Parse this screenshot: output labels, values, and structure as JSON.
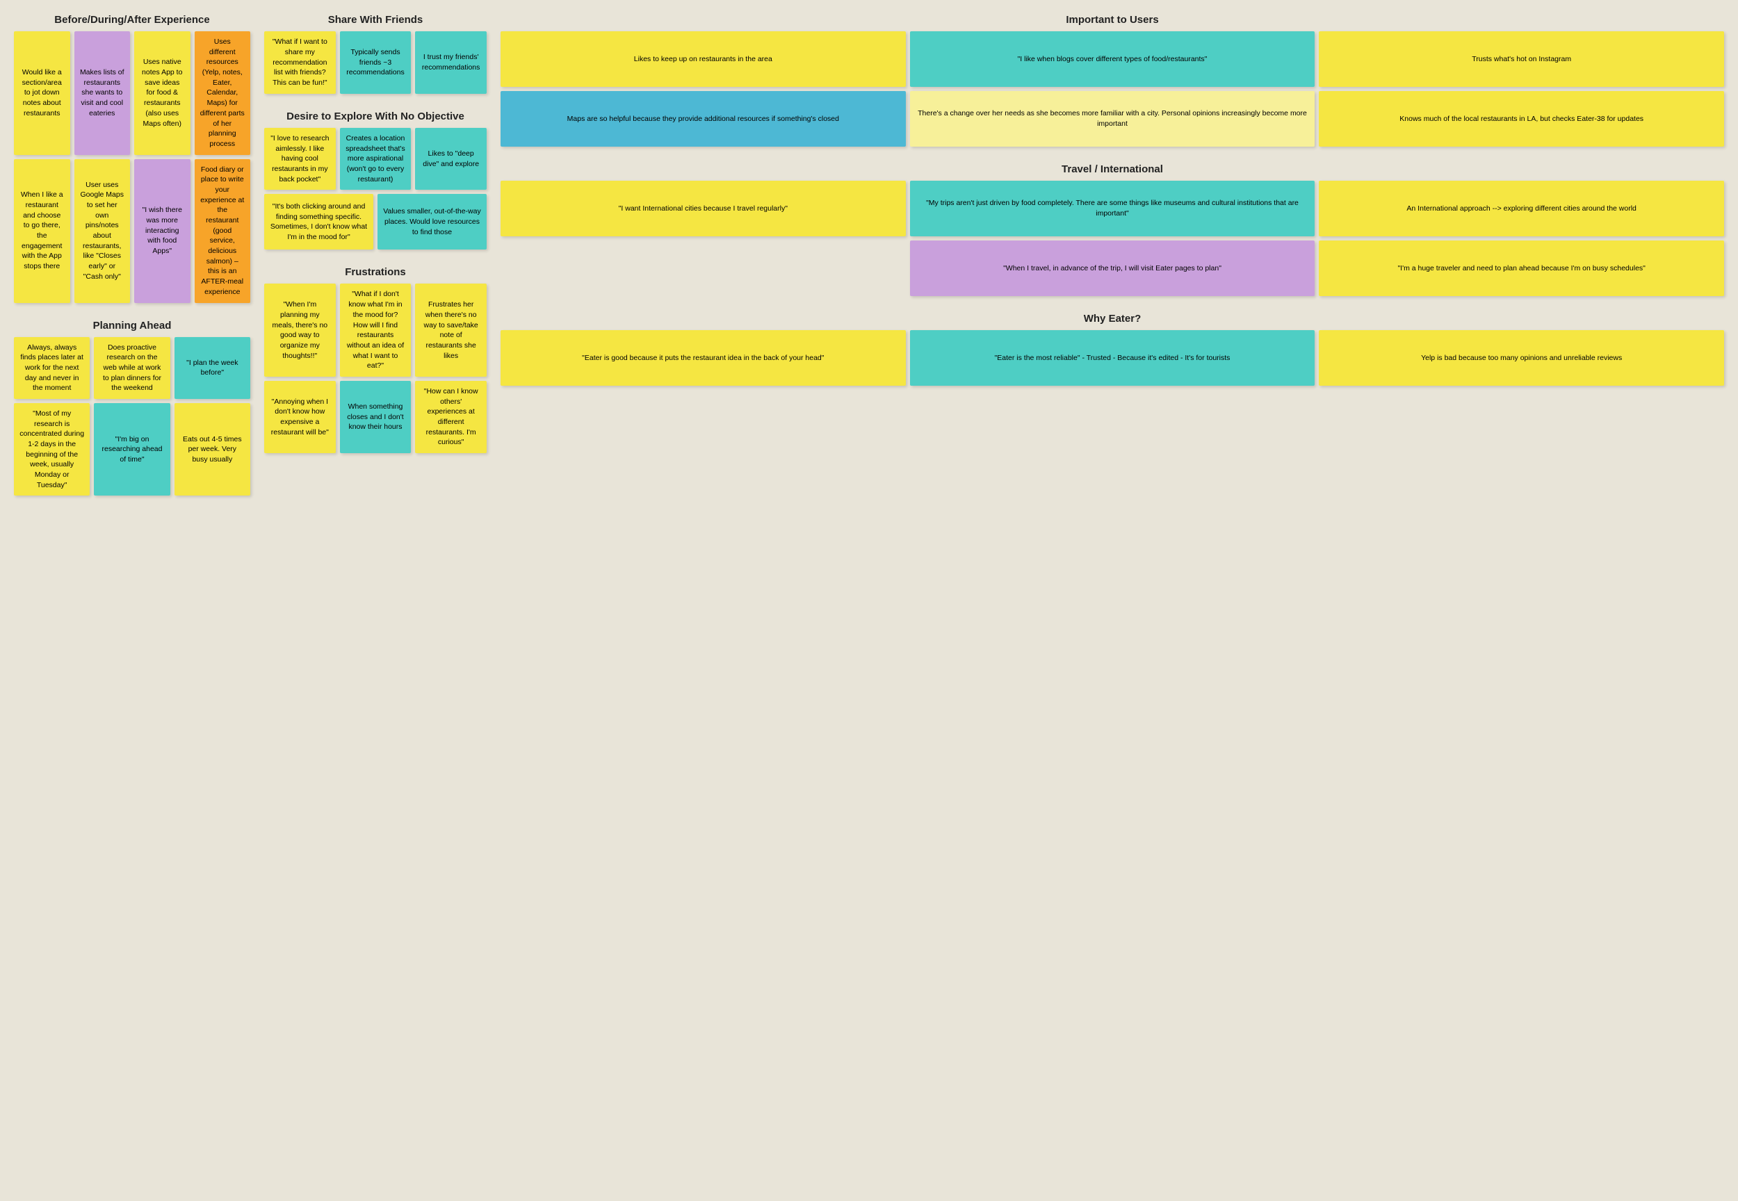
{
  "sections": {
    "beforeDuringAfter": {
      "title": "Before/During/After Experience",
      "row1": [
        {
          "text": "Would like a section/area to jot down notes about restaurants",
          "color": "sticky-yellow"
        },
        {
          "text": "Makes lists of restaurants she wants to visit and cool eateries",
          "color": "sticky-purple"
        },
        {
          "text": "Uses native notes App to save ideas for food & restaurants (also uses Maps often)",
          "color": "sticky-yellow"
        },
        {
          "text": "Uses different resources (Yelp, notes, Eater, Calendar, Maps) for different parts of her planning process",
          "color": "sticky-orange"
        }
      ],
      "row2": [
        {
          "text": "When I like a restaurant and choose to go there, the engagement with the App stops there",
          "color": "sticky-yellow"
        },
        {
          "text": "User uses Google Maps to set her own pins/notes about restaurants, like \"Closes early\" or \"Cash only\"",
          "color": "sticky-yellow"
        },
        {
          "text": "\"I wish there was more interacting with food Apps\"",
          "color": "sticky-purple"
        },
        {
          "text": "Food diary or place to write your experience at the restaurant (good service, delicious salmon) – this is an AFTER-meal experience",
          "color": "sticky-orange"
        }
      ]
    },
    "planningAhead": {
      "title": "Planning Ahead",
      "row1": [
        {
          "text": "Always, always finds places later at work for the next day and never in the moment",
          "color": "sticky-yellow"
        },
        {
          "text": "Does proactive research on the web while at work to plan dinners for the weekend",
          "color": "sticky-yellow"
        },
        {
          "text": "\"I plan the week before\"",
          "color": "sticky-teal"
        }
      ],
      "row2": [
        {
          "text": "\"Most of my research is concentrated during 1-2 days in the beginning of the week, usually Monday or Tuesday\"",
          "color": "sticky-yellow"
        },
        {
          "text": "\"I'm big on researching ahead of time\"",
          "color": "sticky-teal"
        },
        {
          "text": "Eats out 4-5 times per week. Very busy usually",
          "color": "sticky-yellow"
        }
      ]
    },
    "shareWithFriends": {
      "title": "Share With Friends",
      "row1": [
        {
          "text": "\"What if I want to share my recommendation list with friends? This can be fun!\"",
          "color": "sticky-yellow"
        },
        {
          "text": "Typically sends friends ~3 recommendations",
          "color": "sticky-teal"
        },
        {
          "text": "I trust my friends' recommendations",
          "color": "sticky-teal"
        }
      ]
    },
    "desireToExplore": {
      "title": "Desire to Explore With No Objective",
      "row1": [
        {
          "text": "\"I love to research aimlessly. I like having cool restaurants in my back pocket\"",
          "color": "sticky-yellow"
        },
        {
          "text": "Creates a location spreadsheet that's more aspirational (won't go to every restaurant)",
          "color": "sticky-teal"
        },
        {
          "text": "Likes to \"deep dive\" and explore",
          "color": "sticky-teal"
        }
      ],
      "row2": [
        {
          "text": "\"It's both clicking around and finding something specific. Sometimes, I don't know what I'm in the mood for\"",
          "color": "sticky-yellow"
        },
        {
          "text": "Values smaller, out-of-the-way places. Would love resources to find those",
          "color": "sticky-teal"
        }
      ]
    },
    "frustrations": {
      "title": "Frustrations",
      "row1": [
        {
          "text": "\"When I'm planning my meals, there's no good way to organize my thoughts!!\"",
          "color": "sticky-yellow"
        },
        {
          "text": "\"What if I don't know what I'm in the mood for? How will I find restaurants without an idea of what I want to eat?\"",
          "color": "sticky-yellow"
        },
        {
          "text": "Frustrates her when there's no way to save/take note of restaurants she likes",
          "color": "sticky-yellow"
        }
      ],
      "row2": [
        {
          "text": "\"Annoying when I don't know how expensive a restaurant will be\"",
          "color": "sticky-yellow"
        },
        {
          "text": "When something closes and I don't know their hours",
          "color": "sticky-teal"
        },
        {
          "text": "\"How can I know others' experiences at different restaurants. I'm curious\"",
          "color": "sticky-yellow"
        }
      ]
    },
    "importantToUsers": {
      "title": "Important to Users",
      "row1": [
        {
          "text": "Likes to keep up on restaurants in the area",
          "color": "sticky-yellow"
        },
        {
          "text": "\"I like when blogs cover different types of food/restaurants\"",
          "color": "sticky-teal"
        },
        {
          "text": "Trusts what's hot on Instagram",
          "color": "sticky-yellow"
        }
      ],
      "row2": [
        {
          "text": "Maps are so helpful because they provide additional resources if something's closed",
          "color": "sticky-blue"
        },
        {
          "text": "There's a change over her needs as she becomes more familiar with a city. Personal opinions increasingly become more important",
          "color": "sticky-lt-yellow"
        },
        {
          "text": "Knows much of the local restaurants in LA, but checks Eater-38 for updates",
          "color": "sticky-yellow"
        }
      ]
    },
    "travelInternational": {
      "title": "Travel / International",
      "row1": [
        {
          "text": "\"I want International cities because I travel regularly\"",
          "color": "sticky-yellow"
        },
        {
          "text": "\"My trips aren't just driven by food completely. There are some things like museums and cultural institutions that are important\"",
          "color": "sticky-teal"
        },
        {
          "text": "An International approach --> exploring different cities around the world",
          "color": "sticky-yellow"
        }
      ],
      "row2": [
        {
          "text": "\"When I travel, in advance of the trip, I will visit Eater pages to plan\"",
          "color": "sticky-purple"
        },
        {
          "text": "\"I'm a huge traveler and need to plan ahead because I'm on busy schedules\"",
          "color": "sticky-yellow"
        }
      ]
    },
    "whyEater": {
      "title": "Why Eater?",
      "row1": [
        {
          "text": "\"Eater is good because it puts the restaurant idea in the back of your head\"",
          "color": "sticky-yellow"
        },
        {
          "text": "\"Eater is the most reliable\" - Trusted - Because it's edited - It's for tourists",
          "color": "sticky-teal"
        },
        {
          "text": "Yelp is bad because too many opinions and unreliable reviews",
          "color": "sticky-yellow"
        }
      ]
    }
  }
}
